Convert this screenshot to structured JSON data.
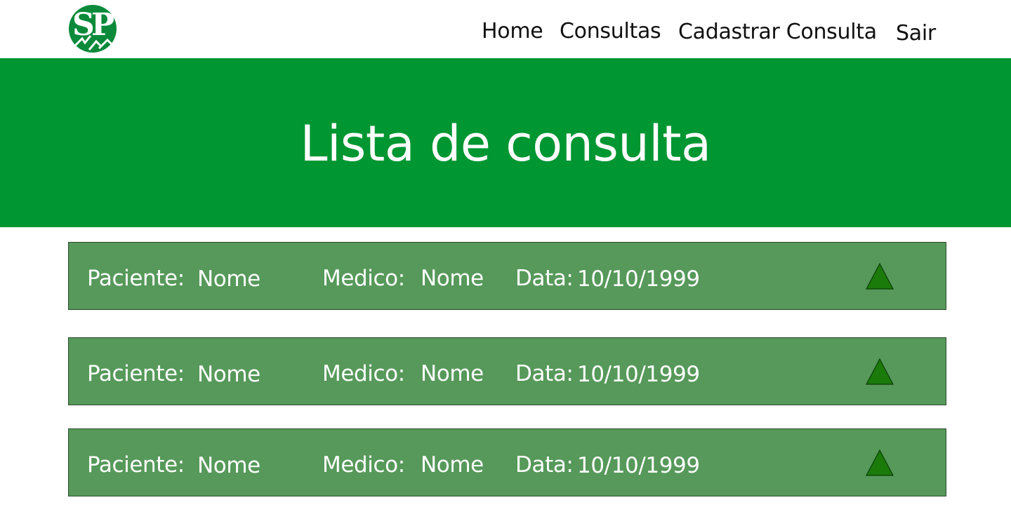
{
  "header": {
    "logo_alt": "SP",
    "nav": [
      {
        "label": "Home"
      },
      {
        "label": "Consultas"
      },
      {
        "label": "Cadastrar Consulta"
      },
      {
        "label": "Sair"
      }
    ]
  },
  "banner": {
    "title": "Lista de consulta",
    "color": "#009632"
  },
  "consultas": {
    "labels": {
      "paciente": "Paciente:",
      "medico": "Medico:",
      "data": "Data:"
    },
    "rows": [
      {
        "paciente": "Nome",
        "medico": "Nome",
        "data": "10/10/1999"
      },
      {
        "paciente": "Nome",
        "medico": "Nome",
        "data": "10/10/1999"
      },
      {
        "paciente": "Nome",
        "medico": "Nome",
        "data": "10/10/1999"
      }
    ],
    "card_color": "#56995a",
    "icon": "triangle-up-icon",
    "icon_color": "#1a7a0a"
  }
}
